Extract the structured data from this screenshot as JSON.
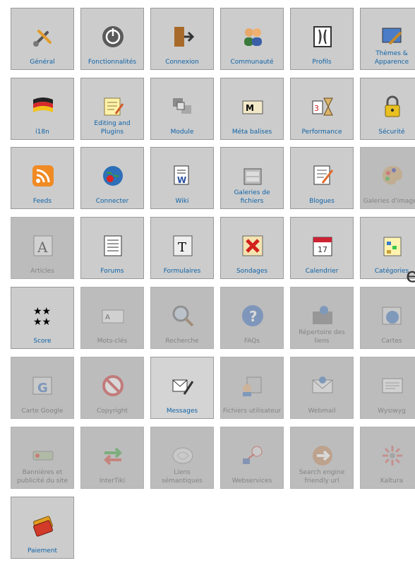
{
  "tiles": [
    {
      "label": "Général",
      "icon": "tools-icon",
      "disabled": false
    },
    {
      "label": "Fonctionnalités",
      "icon": "power-icon",
      "disabled": false
    },
    {
      "label": "Connexion",
      "icon": "door-login-icon",
      "disabled": false
    },
    {
      "label": "Communauté",
      "icon": "users-icon",
      "disabled": false
    },
    {
      "label": "Profils",
      "icon": "profiles-icon",
      "disabled": false
    },
    {
      "label": "Thèmes & Apparence",
      "icon": "theme-brush-icon",
      "disabled": false
    },
    {
      "label": "i18n",
      "icon": "flag-icon",
      "disabled": false
    },
    {
      "label": "Editing and Plugins",
      "icon": "edit-notepad-icon",
      "disabled": false
    },
    {
      "label": "Module",
      "icon": "module-icon",
      "disabled": false
    },
    {
      "label": "Méta balises",
      "icon": "meta-tags-icon",
      "disabled": false
    },
    {
      "label": "Performance",
      "icon": "hourglass-icon",
      "disabled": false
    },
    {
      "label": "Sécurité",
      "icon": "padlock-icon",
      "disabled": false
    },
    {
      "label": "Feeds",
      "icon": "rss-icon",
      "disabled": false
    },
    {
      "label": "Connecter",
      "icon": "connect-globe-icon",
      "disabled": false
    },
    {
      "label": "Wiki",
      "icon": "wiki-icon",
      "disabled": false
    },
    {
      "label": "Galeries de fichiers",
      "icon": "file-cabinet-icon",
      "disabled": false
    },
    {
      "label": "Blogues",
      "icon": "blog-icon",
      "disabled": false
    },
    {
      "label": "Galeries d'images",
      "icon": "palette-icon",
      "disabled": true
    },
    {
      "label": "Articles",
      "icon": "article-icon",
      "disabled": true
    },
    {
      "label": "Forums",
      "icon": "forum-icon",
      "disabled": false
    },
    {
      "label": "Formulaires",
      "icon": "form-icon",
      "disabled": false
    },
    {
      "label": "Sondages",
      "icon": "poll-icon",
      "disabled": false
    },
    {
      "label": "Calendrier",
      "icon": "calendar-icon",
      "disabled": false
    },
    {
      "label": "Catégories",
      "icon": "categories-icon",
      "disabled": false
    },
    {
      "label": "Score",
      "icon": "stars-icon",
      "disabled": false
    },
    {
      "label": "Mots-clés",
      "icon": "keyword-card-icon",
      "disabled": true
    },
    {
      "label": "Recherche",
      "icon": "magnifier-icon",
      "disabled": true
    },
    {
      "label": "FAQs",
      "icon": "question-icon",
      "disabled": true
    },
    {
      "label": "Répertoire des liens",
      "icon": "directory-icon",
      "disabled": true
    },
    {
      "label": "Cartes",
      "icon": "map-icon",
      "disabled": true
    },
    {
      "label": "Carte Google",
      "icon": "google-map-icon",
      "disabled": true
    },
    {
      "label": "Copyright",
      "icon": "no-sign-icon",
      "disabled": true
    },
    {
      "label": "Messages",
      "icon": "messages-icon",
      "disabled": false,
      "active": true
    },
    {
      "label": "Fichiers utilisateur",
      "icon": "user-files-icon",
      "disabled": true
    },
    {
      "label": "Webmail",
      "icon": "webmail-icon",
      "disabled": true
    },
    {
      "label": "Wysiwyg",
      "icon": "wysiwyg-icon",
      "disabled": true
    },
    {
      "label": "Bannières et publicité du site",
      "icon": "banner-icon",
      "disabled": true
    },
    {
      "label": "InterTiki",
      "icon": "exchange-arrows-icon",
      "disabled": true
    },
    {
      "label": "Liens sémantiques",
      "icon": "brain-icon",
      "disabled": true
    },
    {
      "label": "Webservices",
      "icon": "webservices-icon",
      "disabled": true
    },
    {
      "label": "Search engine friendly url",
      "icon": "seo-arrow-icon",
      "disabled": true
    },
    {
      "label": "Kaltura",
      "icon": "kaltura-icon",
      "disabled": true
    },
    {
      "label": "Paiement",
      "icon": "payment-card-icon",
      "disabled": false
    }
  ],
  "partial_letter": "e",
  "colors": {
    "tile_bg": "#cccccc",
    "label": "#0e63a8",
    "disabled_label": "#333333"
  }
}
